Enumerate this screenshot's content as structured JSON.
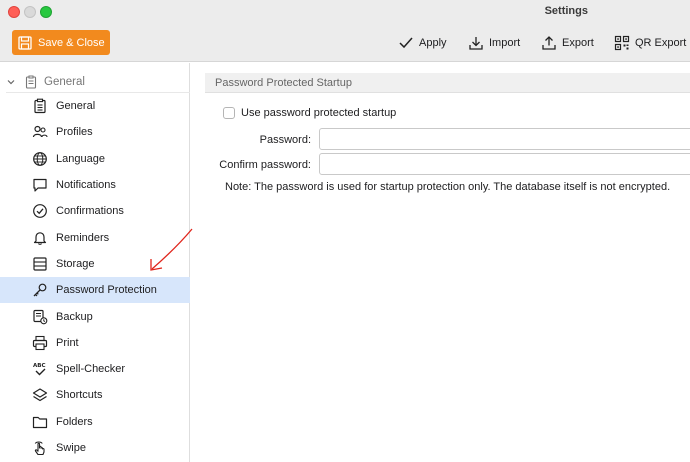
{
  "window": {
    "title": "Settings"
  },
  "toolbar": {
    "save_label": "Save & Close",
    "apply_label": "Apply",
    "import_label": "Import",
    "export_label": "Export",
    "qr_export_label": "QR Export",
    "accent_color": "#f28a1e"
  },
  "sidebar": {
    "group_label": "General",
    "items": [
      {
        "label": "General",
        "icon": "clipboard-icon"
      },
      {
        "label": "Profiles",
        "icon": "profiles-icon"
      },
      {
        "label": "Language",
        "icon": "globe-icon"
      },
      {
        "label": "Notifications",
        "icon": "speech-bubble-icon"
      },
      {
        "label": "Confirmations",
        "icon": "check-circle-icon"
      },
      {
        "label": "Reminders",
        "icon": "bell-icon"
      },
      {
        "label": "Storage",
        "icon": "storage-icon"
      },
      {
        "label": "Password Protection",
        "icon": "key-icon"
      },
      {
        "label": "Backup",
        "icon": "backup-icon"
      },
      {
        "label": "Print",
        "icon": "printer-icon"
      },
      {
        "label": "Spell-Checker",
        "icon": "spell-check-icon"
      },
      {
        "label": "Shortcuts",
        "icon": "layers-icon"
      },
      {
        "label": "Folders",
        "icon": "folder-icon"
      },
      {
        "label": "Swipe",
        "icon": "swipe-hand-icon"
      }
    ],
    "selected": "Password Protection",
    "selected_color": "#d7e6fb"
  },
  "main": {
    "section_title": "Password Protected Startup",
    "checkbox_label": "Use password protected startup",
    "checkbox_checked": false,
    "password_label": "Password:",
    "password_value": "",
    "confirm_label": "Confirm password:",
    "confirm_value": "",
    "note": "Note: The password is used for startup protection only. The database itself is not encrypted."
  }
}
